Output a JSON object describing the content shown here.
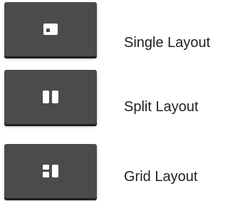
{
  "layouts": [
    {
      "id": "single",
      "label": "Single Layout",
      "icon": "single-layout-icon"
    },
    {
      "id": "split",
      "label": "Split Layout",
      "icon": "split-layout-icon"
    },
    {
      "id": "grid",
      "label": "Grid Layout",
      "icon": "grid-layout-icon"
    }
  ],
  "colors": {
    "button_bg": "#4b4b4b",
    "icon": "#ffffff",
    "icon_inner": "#4b4b4b",
    "text": "#222222"
  }
}
